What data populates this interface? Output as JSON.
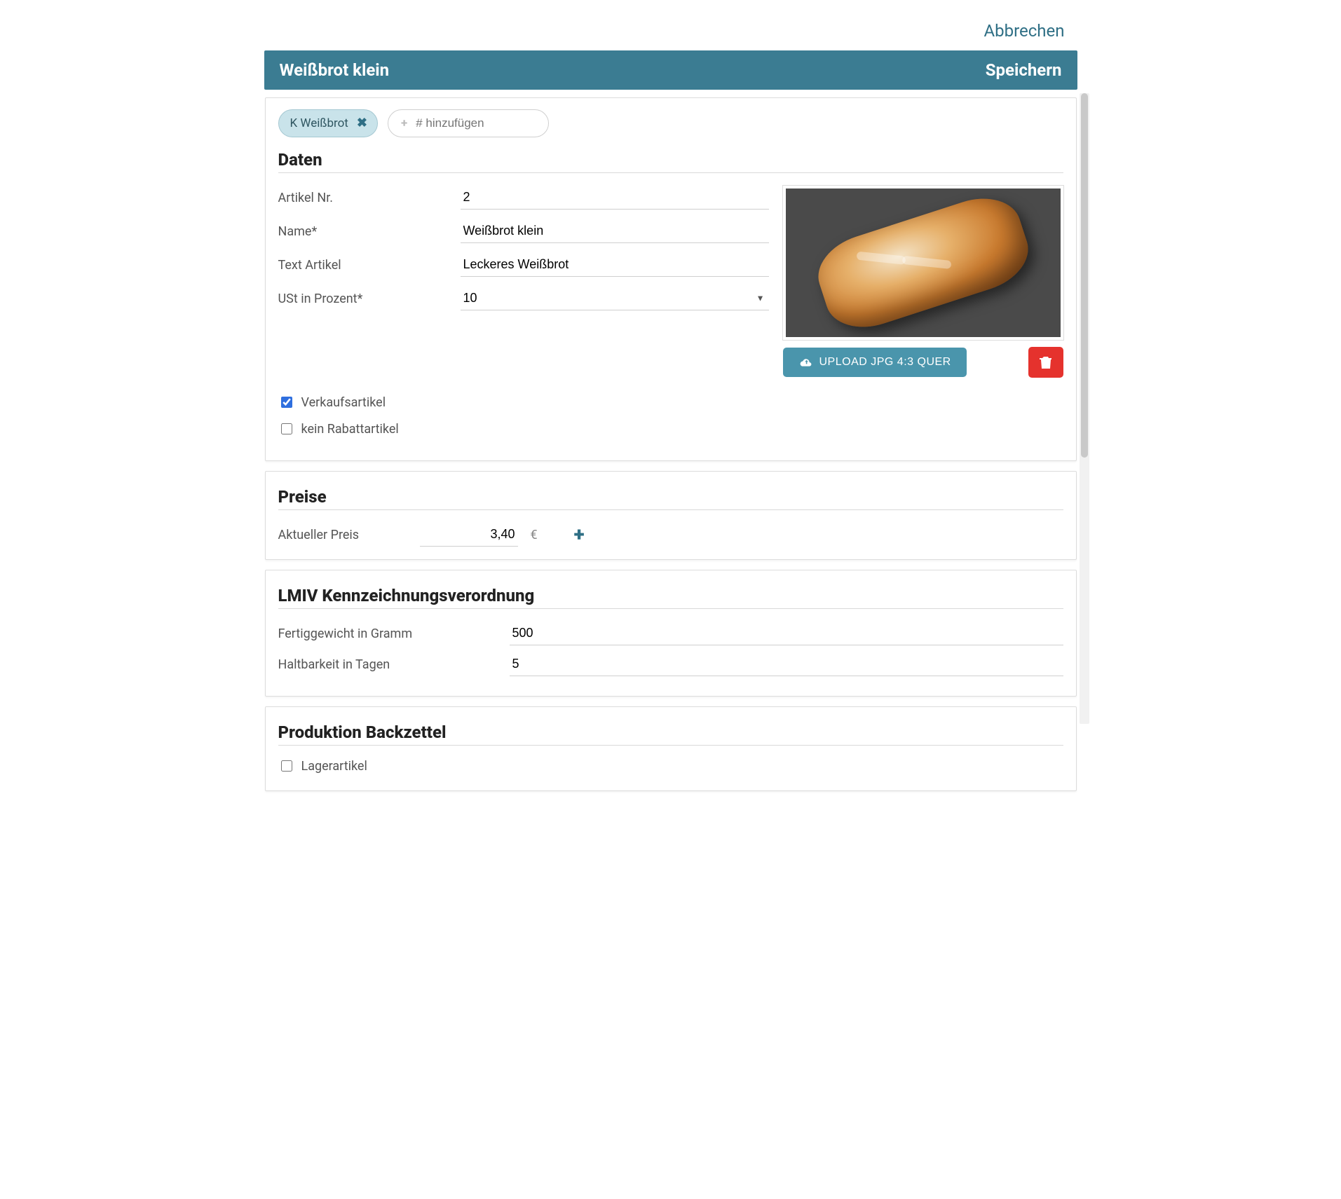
{
  "actions": {
    "cancel": "Abbrechen",
    "save": "Speichern"
  },
  "header": {
    "title": "Weißbrot klein"
  },
  "tags": {
    "items": [
      "K Weißbrot"
    ],
    "add_placeholder": "# hinzufügen"
  },
  "sections": {
    "daten_title": "Daten",
    "preise_title": "Preise",
    "lmiv_title": "LMIV  Kennzeichnungsverordnung",
    "produktion_title": "Produktion Backzettel"
  },
  "daten": {
    "labels": {
      "artikel_nr": "Artikel Nr.",
      "name": "Name*",
      "text_artikel": "Text Artikel",
      "ust": "USt in Prozent*"
    },
    "values": {
      "artikel_nr": "2",
      "name": "Weißbrot klein",
      "text_artikel": "Leckeres Weißbrot",
      "ust": "10"
    },
    "upload_label": "UPLOAD JPG 4:3 QUER",
    "checkboxes": {
      "verkaufsartikel_label": "Verkaufsartikel",
      "verkaufsartikel_checked": true,
      "kein_rabatt_label": "kein Rabattartikel",
      "kein_rabatt_checked": false
    }
  },
  "preise": {
    "current_label": "Aktueller Preis",
    "current_value": "3,40",
    "currency": "€"
  },
  "lmiv": {
    "labels": {
      "fertiggewicht": "Fertiggewicht in Gramm",
      "haltbarkeit": "Haltbarkeit in Tagen"
    },
    "values": {
      "fertiggewicht": "500",
      "haltbarkeit": "5"
    }
  },
  "produktion": {
    "lagerartikel_label": "Lagerartikel",
    "lagerartikel_checked": false
  }
}
